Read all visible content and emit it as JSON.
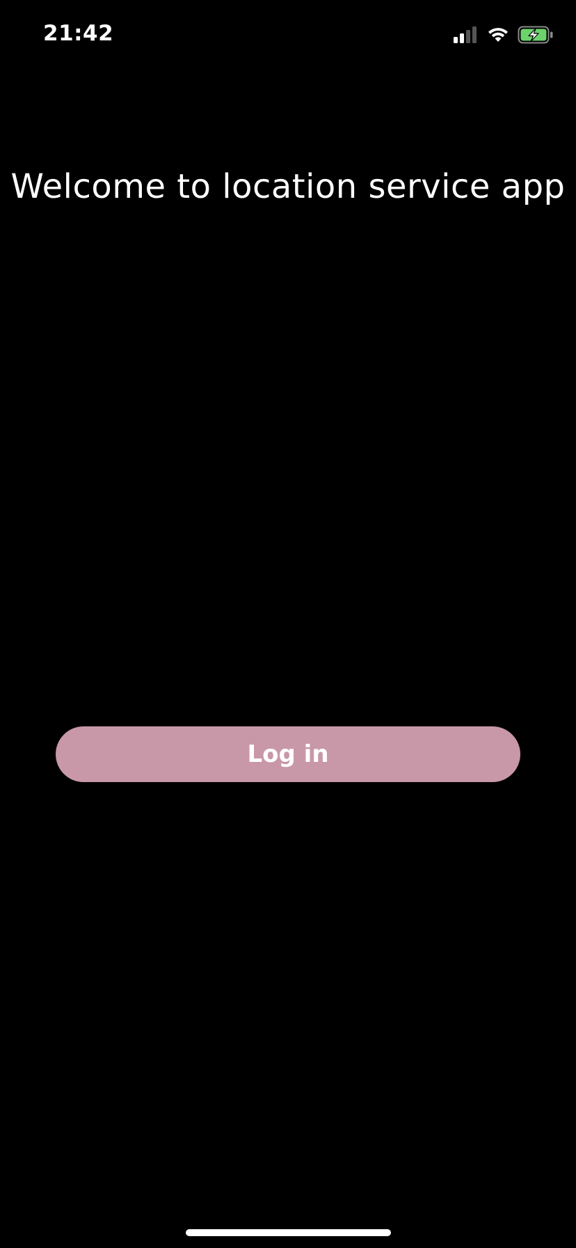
{
  "status_bar": {
    "time": "21:42",
    "icons": [
      "cellular-signal-icon",
      "wifi-icon",
      "battery-charging-icon"
    ],
    "battery_color": "#6cd36c"
  },
  "main": {
    "title": "Welcome to location service app",
    "login_label": "Log in"
  },
  "colors": {
    "background": "#000000",
    "button": "#c898a8",
    "text": "#ffffff"
  }
}
